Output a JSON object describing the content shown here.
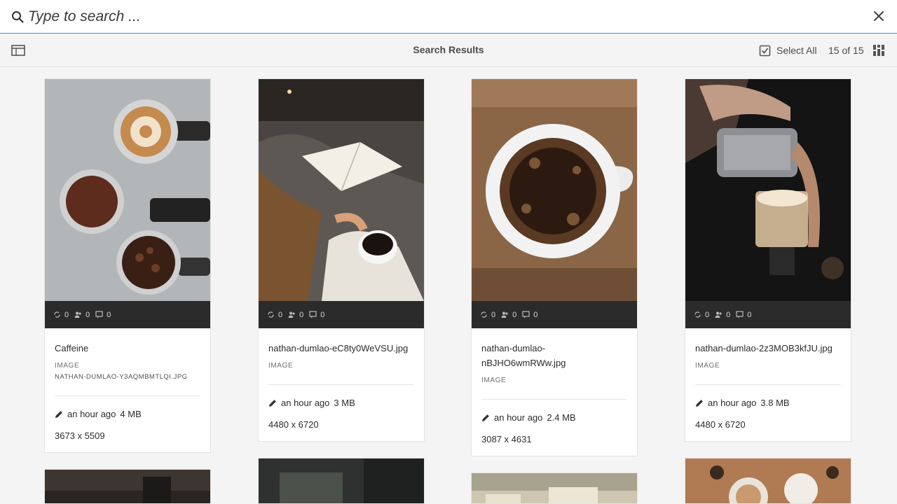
{
  "search": {
    "placeholder": "Type to search ..."
  },
  "actionbar": {
    "title": "Search Results",
    "select_all": "Select All",
    "count": "15 of 15"
  },
  "cards": [
    {
      "title": "Caffeine",
      "type": "IMAGE",
      "filename": "NATHAN-DUMLAO-Y3AQMBMTLQI.JPG",
      "modified": "an hour ago",
      "size": "4 MB",
      "dims": "3673 x 5509",
      "stats": [
        "0",
        "0",
        "0"
      ]
    },
    {
      "title": "nathan-dumlao-eC8ty0WeVSU.jpg",
      "type": "IMAGE",
      "modified": "an hour ago",
      "size": "3 MB",
      "dims": "4480 x 6720",
      "stats": [
        "0",
        "0",
        "0"
      ]
    },
    {
      "title": "nathan-dumlao-nBJHO6wmRWw.jpg",
      "type": "IMAGE",
      "modified": "an hour ago",
      "size": "2.4 MB",
      "dims": "3087 x 4631",
      "stats": [
        "0",
        "0",
        "0"
      ]
    },
    {
      "title": "nathan-dumlao-2z3MOB3kfJU.jpg",
      "type": "IMAGE",
      "modified": "an hour ago",
      "size": "3.8 MB",
      "dims": "4480 x 6720",
      "stats": [
        "0",
        "0",
        "0"
      ]
    }
  ],
  "icons": {
    "search": "search-icon",
    "close": "close-icon",
    "rail": "rail-toggle-icon",
    "select_all": "checkbox-icon",
    "view": "grid-view-icon",
    "versions": "sync-icon",
    "people": "people-icon",
    "comments": "comment-icon",
    "edit": "pencil-icon"
  },
  "colors": {
    "accent": "#378ef0",
    "background": "#f4f4f4",
    "card": "#ffffff",
    "stats_bar": "#2b2b2b"
  }
}
